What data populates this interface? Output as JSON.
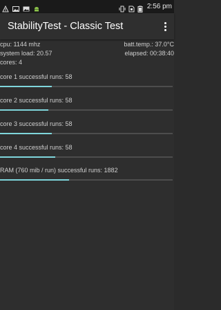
{
  "status_bar": {
    "time": "2:56 pm",
    "left_icons": [
      "warning-icon",
      "image-icon",
      "image-icon",
      "android-icon"
    ],
    "right_icons": [
      "vibrate-icon",
      "sim-icon",
      "battery-icon"
    ]
  },
  "app_bar": {
    "title": "StabilityTest - Classic Test",
    "menu_icon": "overflow-menu-icon"
  },
  "stats": {
    "cpu": "cpu: 1144 mhz",
    "batt_temp": "batt.temp.: 37.0°C",
    "system_load": "system load: 20.57",
    "elapsed": "elapsed: 00:38:40",
    "cores": "cores: 4"
  },
  "tests": [
    {
      "label": "core 1 successful runs: 58",
      "progress": 0.3
    },
    {
      "label": "core 2 successful runs: 58",
      "progress": 0.28
    },
    {
      "label": "core 3 successful runs: 58",
      "progress": 0.3
    },
    {
      "label": "core 4 successful runs: 58",
      "progress": 0.32
    },
    {
      "label": "RAM (760 mib / run) successful runs: 1882",
      "progress": 0.4
    }
  ],
  "colors": {
    "progress_fill": "#7fd6dc",
    "progress_track": "#4d4d4d",
    "background": "#2e2e2e"
  }
}
